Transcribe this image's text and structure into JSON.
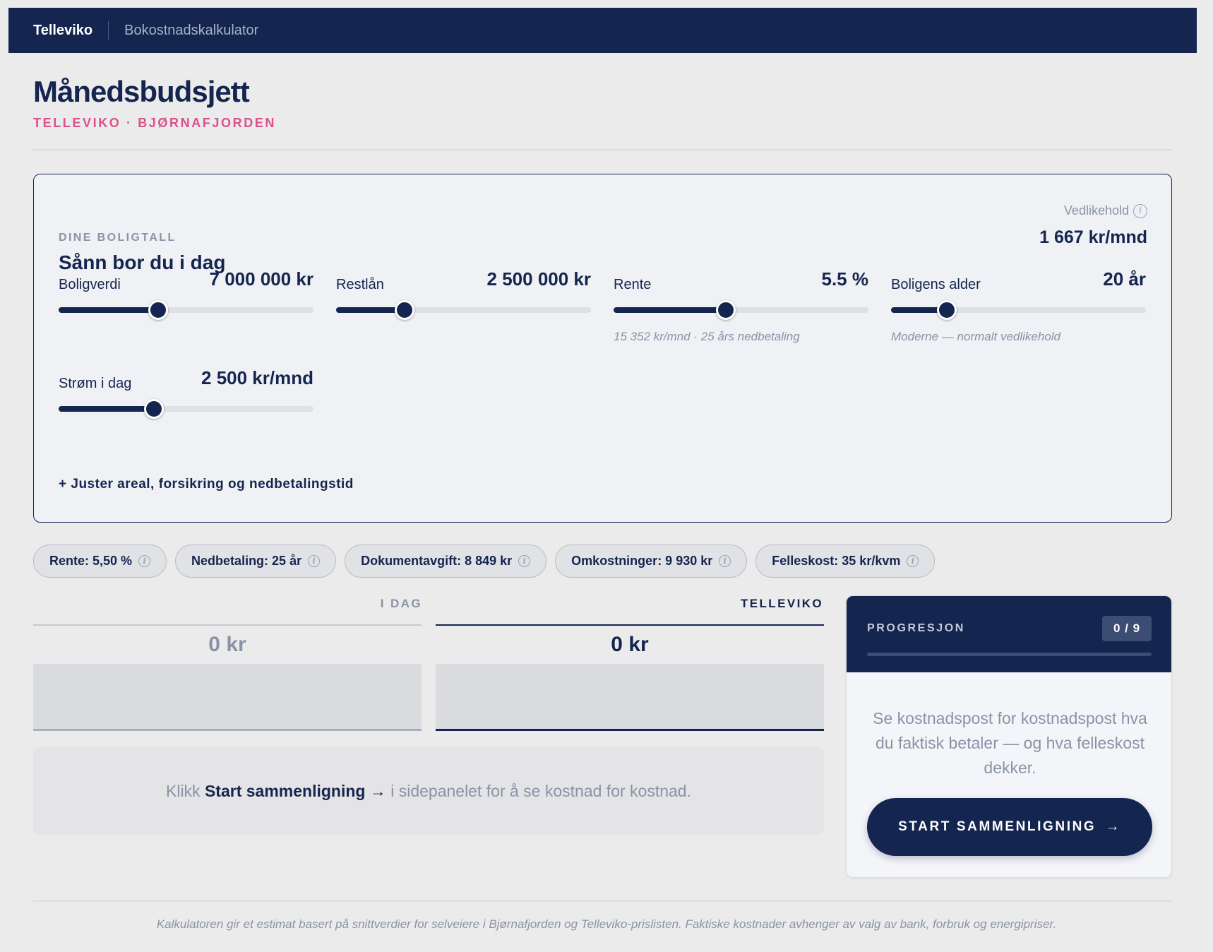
{
  "nav": {
    "brand": "Telleviko",
    "app_name": "Bokostnadskalkulator"
  },
  "header": {
    "title": "Månedsbudsjett",
    "subtitle": "TELLEVIKO · BJØRNAFJORDEN"
  },
  "housing": {
    "kicker": "DINE BOLIGTALL",
    "title": "Sånn bor du i dag",
    "maintenance_label": "Vedlikehold",
    "maintenance_value": "1 667 kr/mnd",
    "sliders": [
      {
        "label": "Boligverdi",
        "value": "7 000 000 kr",
        "level": 0.39,
        "hint": ""
      },
      {
        "label": "Restlån",
        "value": "2 500 000 kr",
        "level": 0.27,
        "hint": ""
      },
      {
        "label": "Rente",
        "value": "5.5 %",
        "level": 0.44,
        "hint": "15 352 kr/mnd · 25 års nedbetaling"
      },
      {
        "label": "Boligens alder",
        "value": "20 år",
        "level": 0.22,
        "hint": "Moderne — normalt vedlikehold"
      },
      {
        "label": "Strøm i dag",
        "value": "2 500 kr/mnd",
        "level": 0.375,
        "hint": ""
      }
    ],
    "adjust_link": "+ Juster areal, forsikring og nedbetalingstid"
  },
  "chips": [
    "Rente: 5,50 %",
    "Nedbetaling: 25 år",
    "Dokumentavgift: 8 849 kr",
    "Omkostninger: 9 930 kr",
    "Felleskost: 35 kr/kvm"
  ],
  "comparison": {
    "today": {
      "label": "I DAG",
      "value": "0 kr"
    },
    "telleviko": {
      "label": "TELLEVIKO",
      "value": "0 kr"
    },
    "hint_before": "Klikk ",
    "hint_bold": "Start sammenligning →",
    "hint_after": " i sidepanelet for å se kostnad for kostnad."
  },
  "progress": {
    "kicker": "PROGRESJON",
    "counter": "0 / 9",
    "level": 0,
    "text": "Se kostnadspost for kostnadspost hva du faktisk betaler — og hva felleskost dekker.",
    "button": "START SAMMENLIGNING",
    "button_arrow": "→"
  },
  "footer": "Kalkulatoren gir et estimat basert på snittverdier for selveiere i Bjørnafjorden og Telleviko-prislisten. Faktiske kostnader avhenger av valg av bank, forbruk og energipriser.",
  "colors": {
    "navy": "#14254f",
    "accent": "#d9528a",
    "muted": "#8a93a6",
    "background": "#ebebec"
  }
}
